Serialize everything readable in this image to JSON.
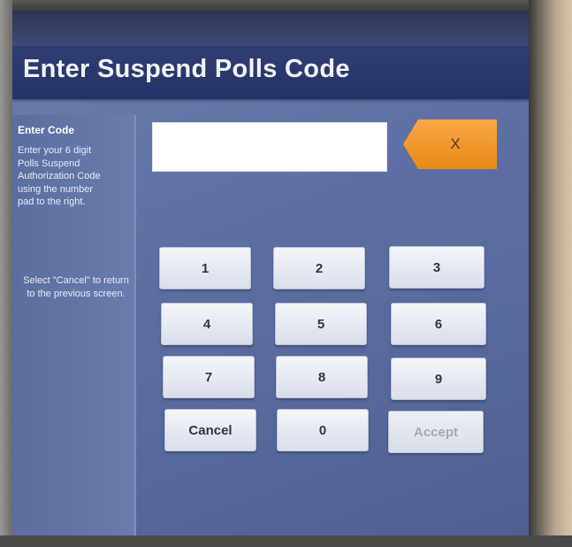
{
  "header": {
    "title": "Enter Suspend Polls Code"
  },
  "sidebar": {
    "title": "Enter Code",
    "instructions": "Enter your 6 digit Polls Suspend Authorization Code using the number pad to the right.",
    "cancel_hint": "Select \"Cancel\" to return to the previous screen."
  },
  "code_input": {
    "value": ""
  },
  "clear_button": {
    "label": "X",
    "color": "#ef9428"
  },
  "keypad": {
    "k1": "1",
    "k2": "2",
    "k3": "3",
    "k4": "4",
    "k5": "5",
    "k6": "6",
    "k7": "7",
    "k8": "8",
    "k9": "9",
    "cancel": "Cancel",
    "k0": "0",
    "accept": "Accept"
  },
  "colors": {
    "header": "#2a376b",
    "screen": "#5d6fa2",
    "accept_disabled_text": "#a5a9b3"
  }
}
